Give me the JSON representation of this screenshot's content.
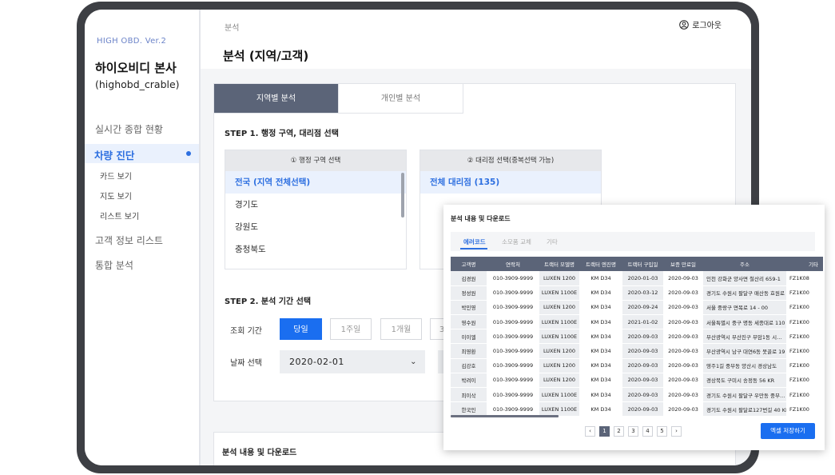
{
  "sidebar": {
    "version": "HIGH OBD. Ver.2",
    "company": "하이오비디 본사",
    "account": "(highobd_crable)",
    "menu": {
      "realtime": "실시간 종합 현황",
      "diagnosis": "차량 진단",
      "card_view": "카드 보기",
      "map_view": "지도 보기",
      "list_view": "리스트 보기",
      "customers": "고객 정보 리스트",
      "analysis": "통합 분석"
    }
  },
  "header": {
    "breadcrumb": "분석",
    "title": "분석 (지역/고객)",
    "logout": "로그아웃"
  },
  "tabs": [
    "지역별 분석",
    "개인별 분석"
  ],
  "step1": {
    "title": "STEP 1. 행정 구역, 대리점 선택",
    "region_header": "① 행정 구역 선택",
    "dealer_header": "② 대리점 선택(중복선택 가능)",
    "regions": [
      "전국 (지역 전체선택)",
      "경기도",
      "강원도",
      "충청북도"
    ],
    "dealers": [
      "전체 대리점 (135)"
    ]
  },
  "step2": {
    "title": "STEP 2. 분석 기간 선택",
    "period_label": "조회 기간",
    "periods": [
      "당일",
      "1주일",
      "1개월",
      "3"
    ],
    "date_label": "날짜 선택",
    "date_value": "2020-02-01"
  },
  "download_section_title": "분석 내용 및 다운로드",
  "popup": {
    "title": "분석 내용 및 다운로드",
    "tabs": [
      "에러코드",
      "소모품 교체",
      "기타"
    ],
    "columns": [
      "고객명",
      "연락처",
      "트랙터 모델명",
      "트랙터 엔진명",
      "트랙터 구입일",
      "보증 만료일",
      "주소",
      "기타"
    ],
    "rows": [
      [
        "김경원",
        "010-3909-9999",
        "LUXEN 1200",
        "KM D34",
        "2020-01-03",
        "2020-09-03",
        "인천 강화군 양사면 철산리 659-1",
        "FZ1K08"
      ],
      [
        "정성원",
        "010-3909-9999",
        "LUXEN 1100E",
        "KM D34",
        "2020-03-12",
        "2020-09-03",
        "경기도 수원시 팔달구 매산동 효원로 1",
        "FZ1K00"
      ],
      [
        "박민영",
        "010-3909-9999",
        "LUXEN 1200",
        "KM D34",
        "2020-09-24",
        "2020-09-03",
        "서울 중랑구 면목로 14 - 00",
        "FZ1K00"
      ],
      [
        "영수원",
        "010-3909-9999",
        "LUXEN 1100E",
        "KM D34",
        "2021-01-02",
        "2020-09-03",
        "서울특별시 중구 명동 세종대로 110",
        "FZ1K00"
      ],
      [
        "이이엘",
        "010-3909-9999",
        "LUXEN 1100E",
        "KM D34",
        "2020-09-03",
        "2020-09-03",
        "부산광역시 부산진구 부암1동 시…",
        "FZ1K00"
      ],
      [
        "최영환",
        "010-3909-9999",
        "LUXEN 1200",
        "KM D34",
        "2020-09-03",
        "2020-09-03",
        "부산광역시 남구 대연6동 못골로 19",
        "FZ1K00"
      ],
      [
        "김강호",
        "010-3909-9999",
        "LUXEN 1200",
        "KM D34",
        "2020-09-03",
        "2020-09-03",
        "영주1길 중부동 양산시 경상남도",
        "FZ1K00"
      ],
      [
        "박려이",
        "010-3909-9999",
        "LUXEN 1200",
        "KM D34",
        "2020-09-03",
        "2020-09-03",
        "경상북도 구미시 송정동 56 KR",
        "FZ1K00"
      ],
      [
        "최이삭",
        "010-3909-9999",
        "LUXEN 1100E",
        "KM D34",
        "2020-09-03",
        "2020-09-03",
        "경기도 수원시 팔달구 우만동 중부…",
        "FZ1K00"
      ],
      [
        "한국인",
        "010-3909-9999",
        "LUXEN 1100E",
        "KM D34",
        "2020-09-03",
        "2020-09-03",
        "경기도 수원시 팔달로127번길 40 KR",
        "FZ1K00"
      ]
    ],
    "pagination": [
      "‹",
      "1",
      "2",
      "3",
      "4",
      "5",
      "›"
    ],
    "excel_button": "엑셀 저장하기"
  },
  "colors": {
    "accent": "#1a6ef0",
    "tab_active": "#5b6478",
    "sidebar_active": "#2d6fe0",
    "device_frame": "#3d3f44"
  }
}
